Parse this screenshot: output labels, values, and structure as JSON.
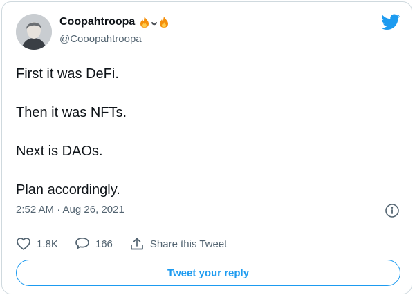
{
  "tweet": {
    "display_name": "Coopahtroopa",
    "handle": "@Cooopahtroopa",
    "lines": [
      "First it was DeFi.",
      "Then it was NFTs.",
      "Next is DAOs.",
      "Plan accordingly."
    ],
    "timestamp": "2:52 AM · Aug 26, 2021"
  },
  "actions": {
    "like_count": "1.8K",
    "reply_count": "166",
    "share_label": "Share this Tweet"
  },
  "reply_button": {
    "label": "Tweet your reply"
  },
  "icons": {
    "name_emojis": [
      "fire-emoji",
      "smile-emoji",
      "fire-emoji"
    ],
    "brand": "twitter-bird-icon",
    "info": "info-icon",
    "like": "heart-icon",
    "reply": "speech-bubble-icon",
    "share": "share-upload-icon"
  },
  "colors": {
    "accent": "#1d9bf0",
    "text": "#0f1419",
    "secondary": "#536471",
    "border": "#cfd9de"
  }
}
